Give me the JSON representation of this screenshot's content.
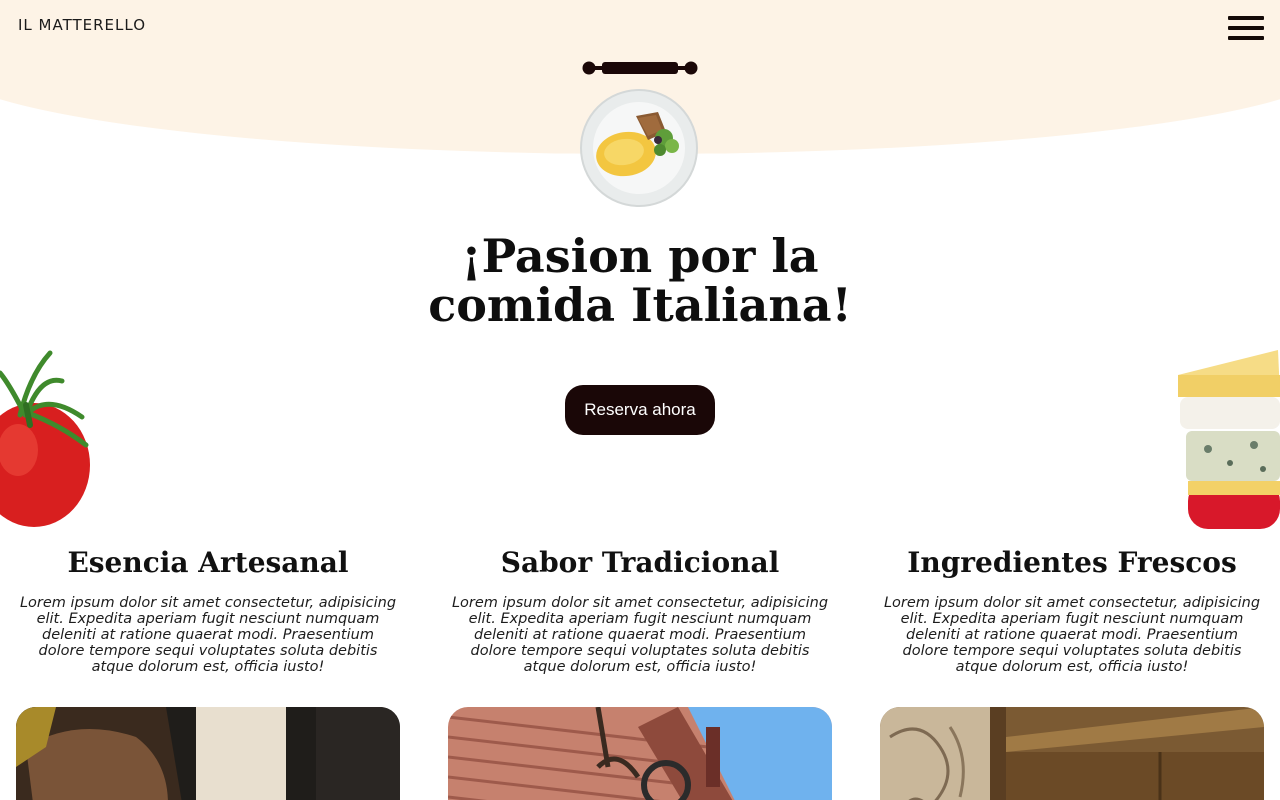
{
  "brand": "IL MATTERELLO",
  "hero": {
    "title_line1": "¡Pasion por la",
    "title_line2": "comida Italiana!",
    "cta_label": "Reserva ahora"
  },
  "features": [
    {
      "title": "Esencia Artesanal",
      "text": "Lorem ipsum dolor sit amet consectetur, adipisicing elit. Expedita aperiam fugit nesciunt numquam deleniti at ratione quaerat modi. Praesentium dolore tempore sequi voluptates soluta debitis atque dolorum est, officia iusto!"
    },
    {
      "title": "Sabor Tradicional",
      "text": "Lorem ipsum dolor sit amet consectetur, adipisicing elit. Expedita aperiam fugit nesciunt numquam deleniti at ratione quaerat modi. Praesentium dolore tempore sequi voluptates soluta debitis atque dolorum est, officia iusto!"
    },
    {
      "title": "Ingredientes Frescos",
      "text": "Lorem ipsum dolor sit amet consectetur, adipisicing elit. Expedita aperiam fugit nesciunt numquam deleniti at ratione quaerat modi. Praesentium dolore tempore sequi voluptates soluta debitis atque dolorum est, officia iusto!"
    }
  ],
  "icons": {
    "menu": "hamburger-menu-icon",
    "rolling_pin": "rolling-pin-icon"
  },
  "colors": {
    "header_bg": "#fdf3e6",
    "accent_dark": "#1a0707",
    "text": "#111111"
  }
}
